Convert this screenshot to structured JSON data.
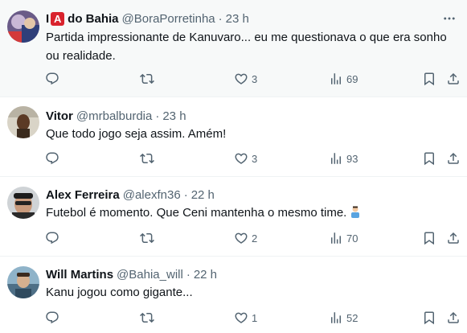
{
  "tweets": [
    {
      "name_prefix": "I",
      "name_badge": "A",
      "name": "do Bahia",
      "handle": "@BoraPorretinha",
      "dot": "·",
      "time": "23 h",
      "text": "Partida impressionante de Kanuvaro... eu me questionava o que era sonho ou realidade.",
      "replies": "",
      "retweets": "",
      "likes": "3",
      "views": "69"
    },
    {
      "name": "Vitor",
      "handle": "@mrbalburdia",
      "dot": "·",
      "time": "23 h",
      "text": "Que todo jogo seja assim. Amém!",
      "replies": "",
      "retweets": "",
      "likes": "3",
      "views": "93"
    },
    {
      "name": "Alex Ferreira",
      "handle": "@alexfn36",
      "dot": "·",
      "time": "22 h",
      "text": "Futebol é momento. Que Ceni mantenha o mesmo time.",
      "replies": "",
      "retweets": "",
      "likes": "2",
      "views": "70"
    },
    {
      "name": "Will Martins",
      "handle": "@Bahia_will",
      "dot": "·",
      "time": "22 h",
      "text": "Kanu jogou como gigante...",
      "replies": "",
      "retweets": "",
      "likes": "1",
      "views": "52"
    }
  ],
  "icons": {
    "reply": "reply-icon",
    "retweet": "retweet-icon",
    "like": "heart-icon",
    "views": "views-chart-icon",
    "bookmark": "bookmark-icon",
    "share": "share-icon",
    "more": "more-icon"
  },
  "colors": {
    "text": "#0f1419",
    "secondary": "#536471",
    "divider": "#eff3f4",
    "highlight_bg": "#f7f9f9",
    "badge_red": "#d9232d"
  }
}
